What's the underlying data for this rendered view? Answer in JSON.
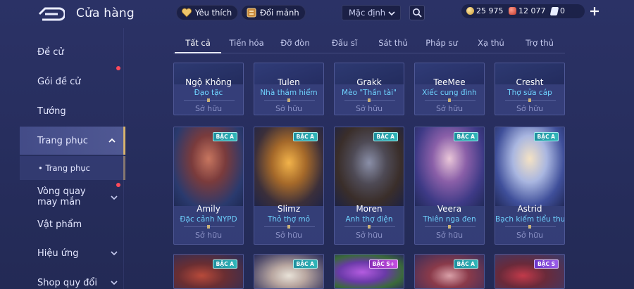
{
  "header": {
    "title": "Cửa hàng",
    "favorites_label": "Yêu thích",
    "exchange_label": "Đổi mảnh",
    "sort_value": "Mặc định",
    "currencies": {
      "gold": "25 975",
      "vouchers": "12 077",
      "diamonds": "0"
    }
  },
  "sidebar": {
    "items": [
      {
        "label": "Đề cử"
      },
      {
        "label": "Gói đề cử"
      },
      {
        "label": "Tướng"
      },
      {
        "label": "Trang phục"
      },
      {
        "label": "• Trang phục"
      },
      {
        "label": "Vòng quay may mắn"
      },
      {
        "label": "Vật phẩm"
      },
      {
        "label": "Hiệu ứng"
      },
      {
        "label": "Shop quy đổi"
      }
    ]
  },
  "tabs": [
    "Tất cả",
    "Tiến hóa",
    "Đỡ đòn",
    "Đấu sĩ",
    "Sát thủ",
    "Pháp sư",
    "Xạ thủ",
    "Trợ thủ"
  ],
  "row1": [
    {
      "hero": "Ngộ Không",
      "skin": "Đạo tặc",
      "status": "Sở hữu"
    },
    {
      "hero": "Tulen",
      "skin": "Nhà thám hiểm",
      "status": "Sở hữu"
    },
    {
      "hero": "Grakk",
      "skin": "Mèo \"Thần tài\"",
      "status": "Sở hữu"
    },
    {
      "hero": "TeeMee",
      "skin": "Xiếc cung đình",
      "status": "Sở hữu"
    },
    {
      "hero": "Cresht",
      "skin": "Thợ sửa cáp",
      "status": "Sở hữu"
    }
  ],
  "row2": [
    {
      "hero": "Amily",
      "skin": "Đặc cảnh NYPD",
      "status": "Sở hữu",
      "tier": "BẬC A"
    },
    {
      "hero": "Slimz",
      "skin": "Thỏ thợ mỏ",
      "status": "Sở hữu",
      "tier": "BẬC A"
    },
    {
      "hero": "Moren",
      "skin": "Anh thợ điện",
      "status": "Sở hữu",
      "tier": "BẬC A"
    },
    {
      "hero": "Veera",
      "skin": "Thiên nga đen",
      "status": "Sở hữu",
      "tier": "BẬC A"
    },
    {
      "hero": "Astrid",
      "skin": "Bạch kiếm tiểu thư",
      "status": "Sở hữu",
      "tier": "BẬC A"
    }
  ],
  "row3_tiers": [
    "BẬC A",
    "BẬC A",
    "BẬC S+",
    "BẬC A",
    "BẬC S"
  ],
  "colors": {
    "accent_gold": "#d9b46a",
    "skin_name": "#6fd3ff",
    "notification": "#ff4a5a"
  },
  "icons": [
    "back-arrow-icon",
    "heart-icon",
    "exchange-icon",
    "chevron-down-icon",
    "search-icon",
    "gold-coin-icon",
    "voucher-icon",
    "diamond-icon",
    "plus-icon",
    "chevron-up-icon"
  ]
}
